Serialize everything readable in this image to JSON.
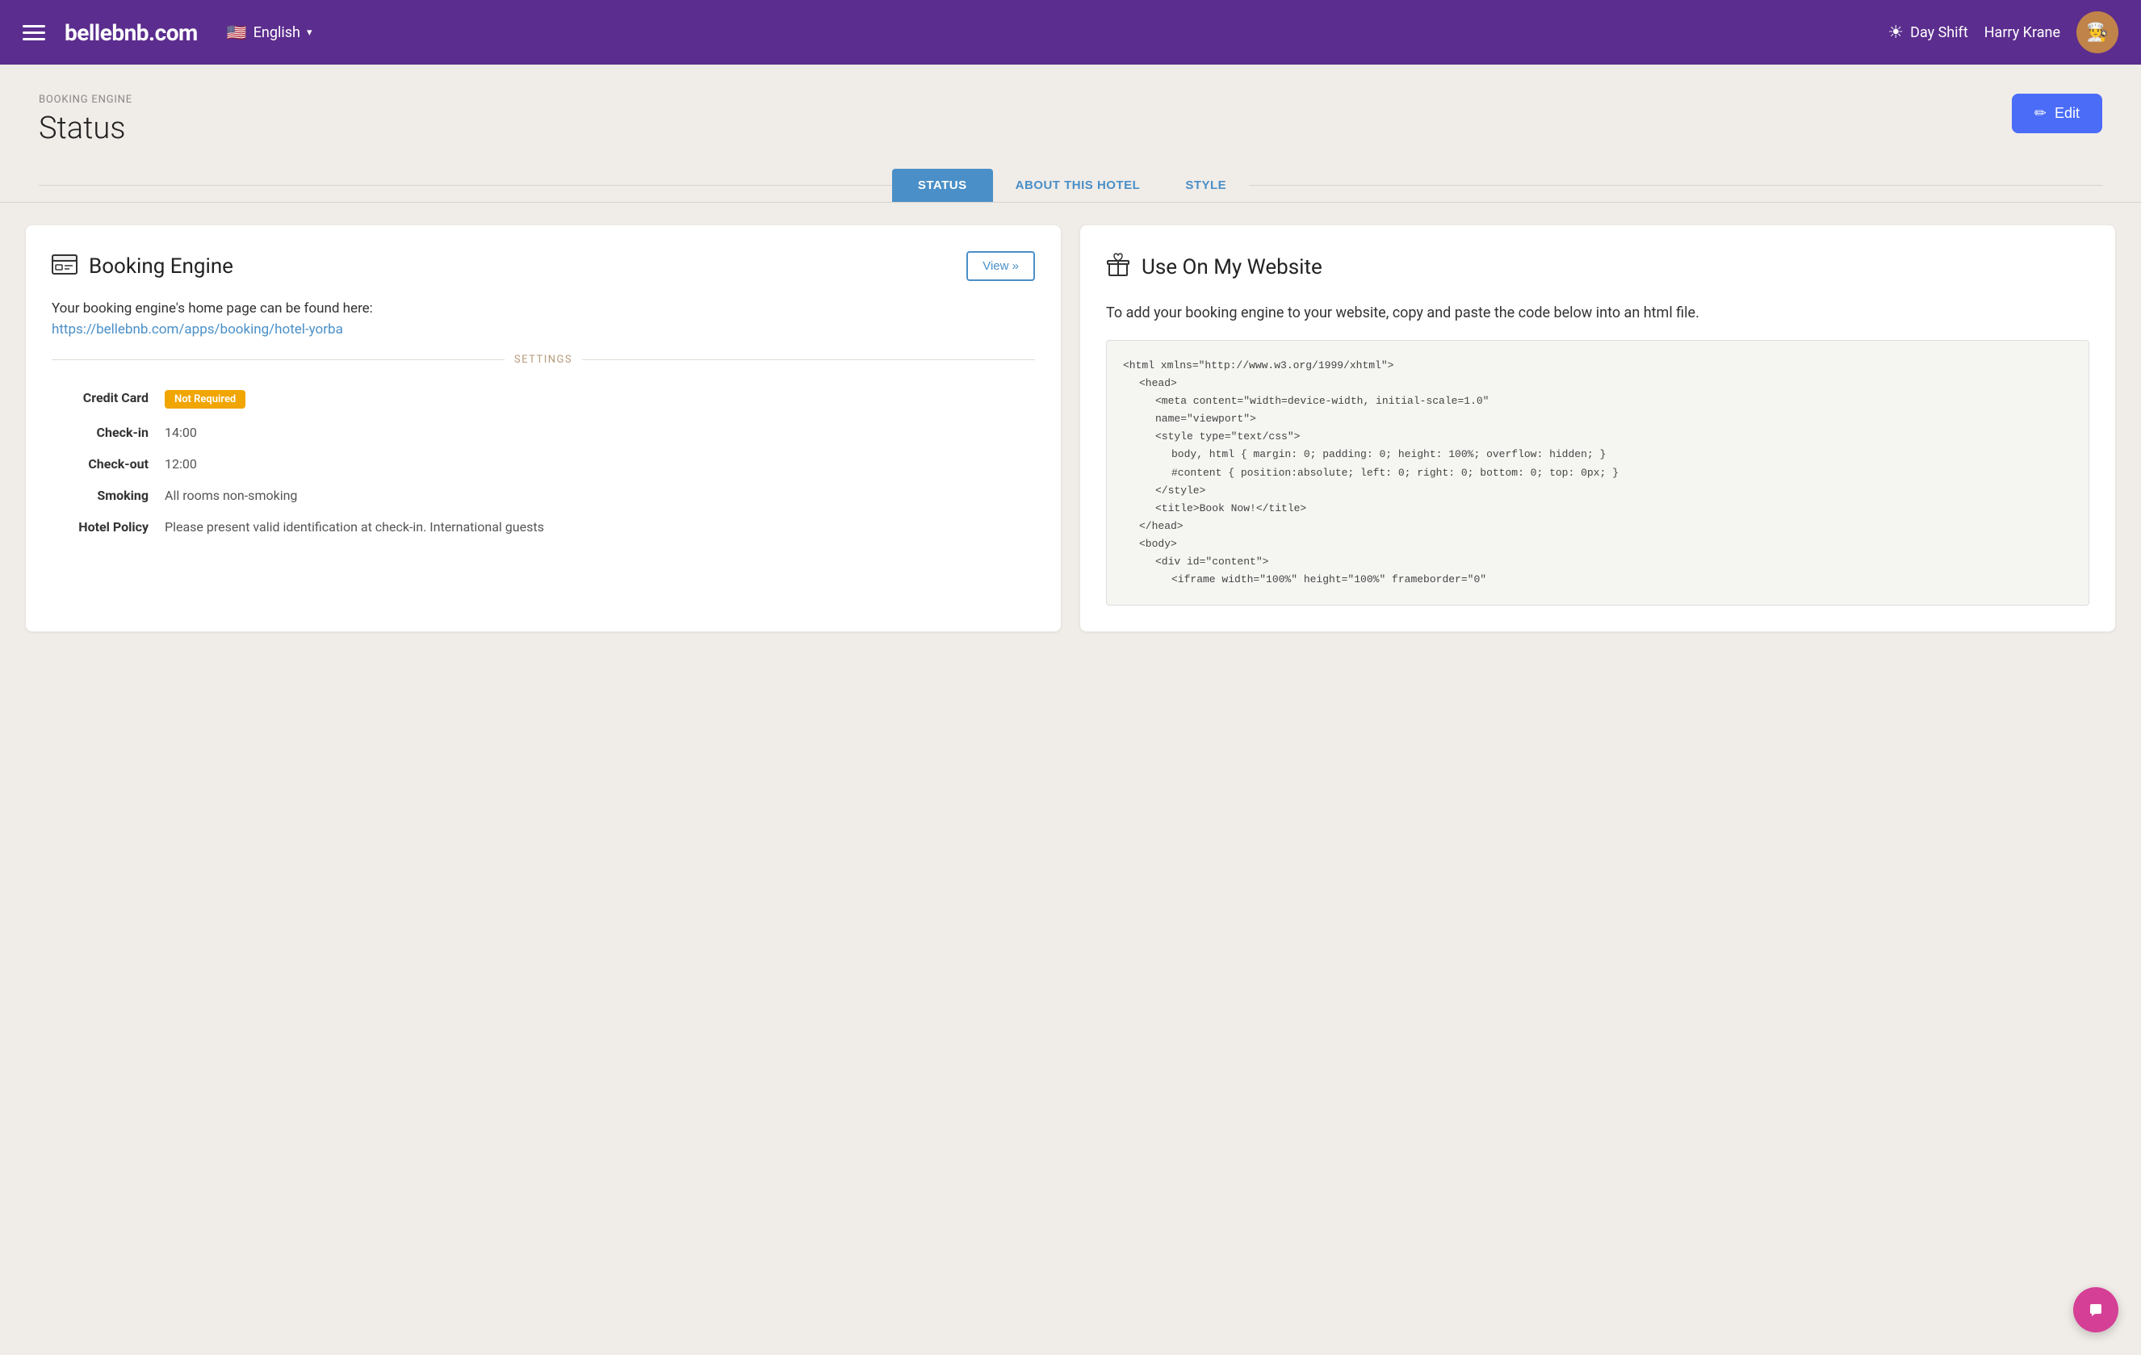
{
  "navbar": {
    "brand": "bellebnb.com",
    "hamburger_label": "menu",
    "flag_emoji": "🇺🇸",
    "language": "English",
    "chevron": "▾",
    "day_shift_label": "Day Shift",
    "sun_icon": "☀",
    "user_name": "Harry Krane",
    "avatar_emoji": "👤"
  },
  "page": {
    "breadcrumb": "BOOKING ENGINE",
    "title": "Status",
    "edit_button_label": "Edit",
    "edit_icon": "✏"
  },
  "tabs": [
    {
      "label": "STATUS",
      "active": true
    },
    {
      "label": "ABOUT THIS HOTEL",
      "active": false
    },
    {
      "label": "STYLE",
      "active": false
    }
  ],
  "booking_card": {
    "title": "Booking Engine",
    "icon": "🗔",
    "view_button": "View »",
    "desc": "Your booking engine's home page can be found here:",
    "link": "https://bellebnb.com/apps/booking/hotel-yorba",
    "settings_label": "SETTINGS",
    "settings": [
      {
        "key": "Credit Card",
        "value": "Not Required",
        "type": "badge"
      },
      {
        "key": "Check-in",
        "value": "14:00",
        "type": "text"
      },
      {
        "key": "Check-out",
        "value": "12:00",
        "type": "text"
      },
      {
        "key": "Smoking",
        "value": "All rooms non-smoking",
        "type": "text"
      },
      {
        "key": "Hotel Policy",
        "value": "Please present valid identification at check-in. International guests",
        "type": "text"
      }
    ]
  },
  "website_card": {
    "title": "Use On My Website",
    "icon": "🎁",
    "desc": "To add your booking engine to your website, copy and paste the code below into an html file.",
    "code_lines": [
      {
        "indent": 0,
        "text": "<html xmlns=\"http://www.w3.org/1999/xhtml\">"
      },
      {
        "indent": 1,
        "text": "<head>"
      },
      {
        "indent": 2,
        "text": "<meta content=\"width=device-width, initial-scale=1.0\""
      },
      {
        "indent": 2,
        "text": "name=\"viewport\">"
      },
      {
        "indent": 2,
        "text": "<style type=\"text/css\">"
      },
      {
        "indent": 3,
        "text": "body, html { margin: 0; padding: 0; height: 100%; overflow: hidden; }"
      },
      {
        "indent": 3,
        "text": "#content { position:absolute; left: 0; right: 0; bottom: 0; top: 0px; }"
      },
      {
        "indent": 2,
        "text": "</style>"
      },
      {
        "indent": 2,
        "text": "<title>Book Now!</title>"
      },
      {
        "indent": 1,
        "text": "</head>"
      },
      {
        "indent": 1,
        "text": "<body>"
      },
      {
        "indent": 2,
        "text": "<div id=\"content\">"
      },
      {
        "indent": 3,
        "text": "<iframe width=\"100%\" height=\"100%\" frameborder=\"0\""
      }
    ]
  },
  "chat_icon": "💬"
}
